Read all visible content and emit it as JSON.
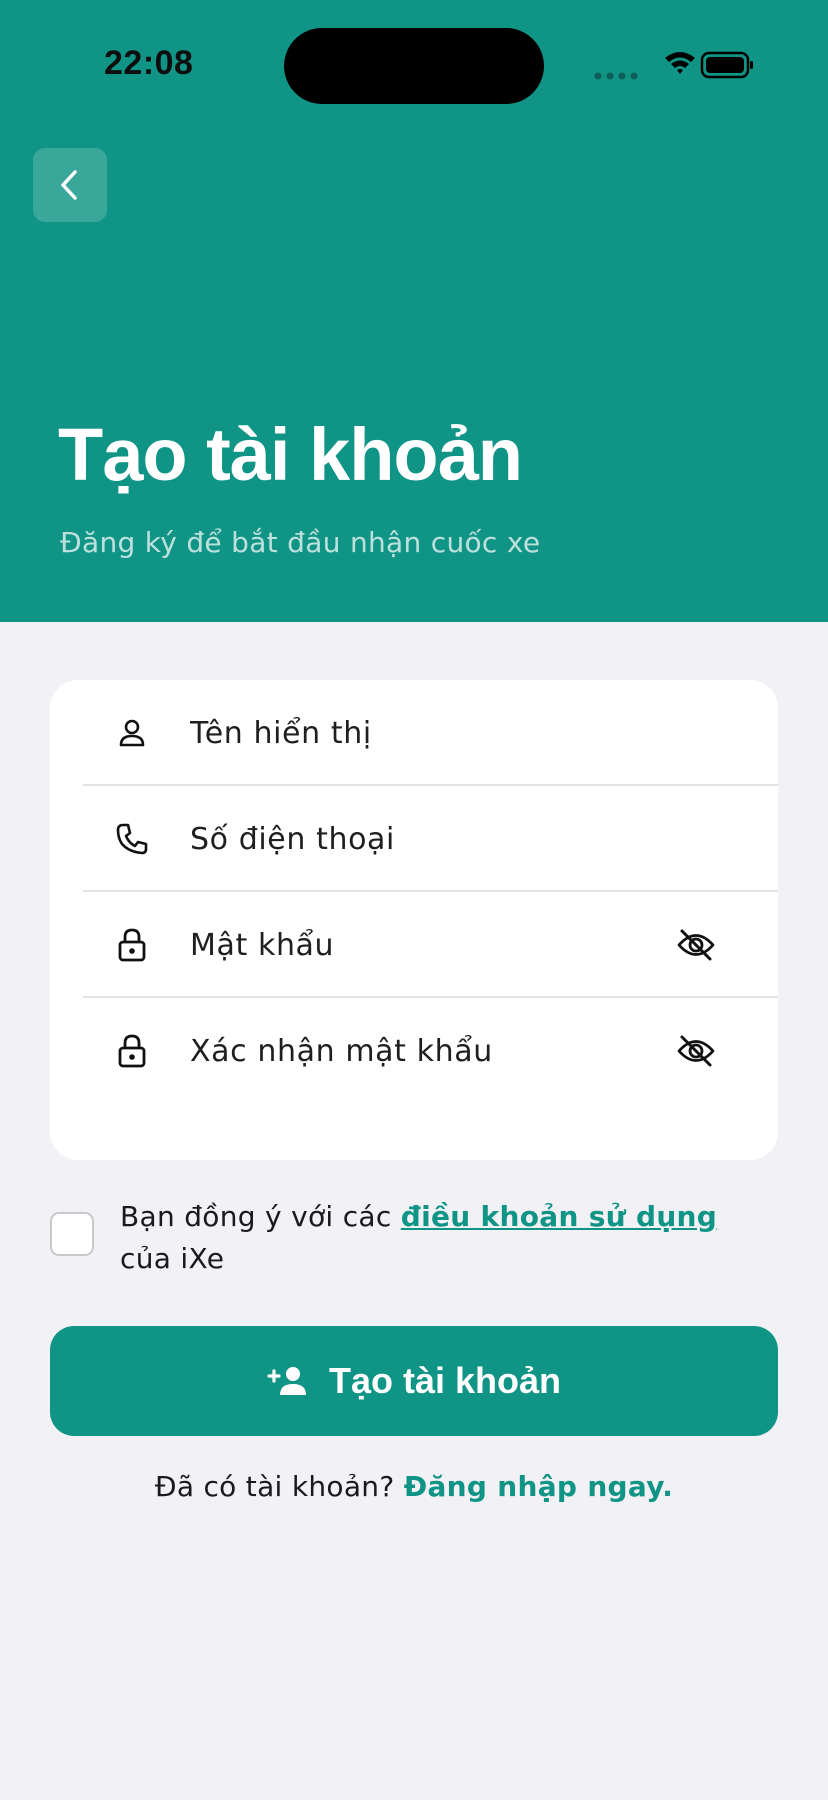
{
  "status_bar": {
    "time": "22:08",
    "icons": [
      "signal-dots-icon",
      "wifi-icon",
      "battery-icon"
    ]
  },
  "header": {
    "back_icon": "chevron-left-icon",
    "title": "Tạo tài khoản",
    "subtitle": "Đăng ký để bắt đầu nhận cuốc xe"
  },
  "form": {
    "fields": [
      {
        "icon": "person-icon",
        "placeholder": "Tên hiển thị"
      },
      {
        "icon": "phone-icon",
        "placeholder": "Số điện thoại"
      },
      {
        "icon": "lock-icon",
        "placeholder": "Mật khẩu",
        "toggle_icon": "eye-off-icon"
      },
      {
        "icon": "lock-icon",
        "placeholder": "Xác nhận mật khẩu",
        "toggle_icon": "eye-off-icon"
      }
    ]
  },
  "terms": {
    "checked": false,
    "prefix": "Bạn đồng ý với các ",
    "link": "điều khoản sử dụng",
    "suffix": " của iXe"
  },
  "primary_button": {
    "icon": "add-person-icon",
    "label": "Tạo tài khoản"
  },
  "login_prompt": {
    "text": "Đã có tài khoản? ",
    "link": "Đăng nhập ngay."
  },
  "colors": {
    "accent": "#0f9485",
    "background": "#f1f1f6",
    "card": "#ffffff"
  }
}
